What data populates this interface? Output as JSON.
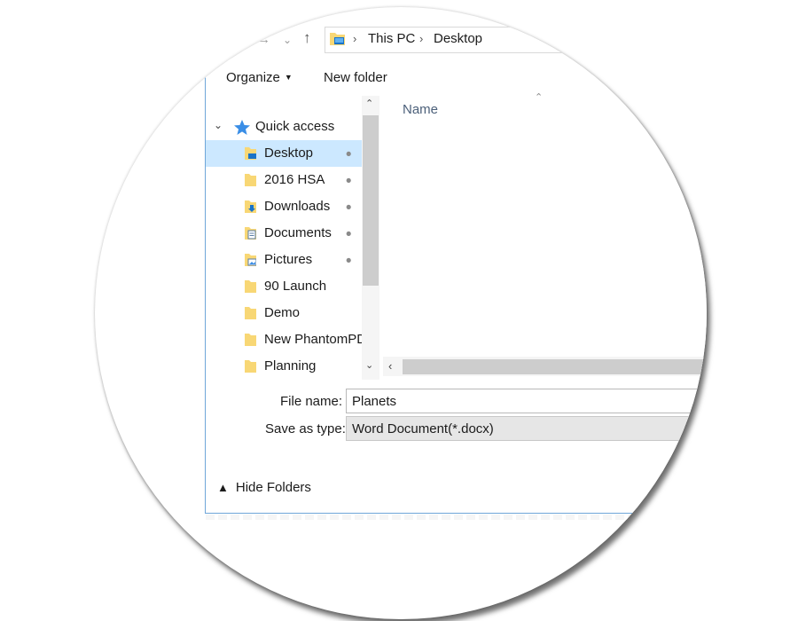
{
  "address_bar": {
    "crumbs": [
      "This PC",
      "Desktop"
    ]
  },
  "toolbar": {
    "organize_label": "Organize",
    "new_folder_label": "New folder"
  },
  "nav_pane": {
    "quick_access_label": "Quick access",
    "items": [
      {
        "label": "Desktop",
        "icon": "desktop-folder-icon",
        "pinned": true,
        "selected": true
      },
      {
        "label": "2016 HSA",
        "icon": "folder-icon",
        "pinned": true
      },
      {
        "label": "Downloads",
        "icon": "downloads-folder-icon",
        "pinned": true
      },
      {
        "label": "Documents",
        "icon": "documents-folder-icon",
        "pinned": true
      },
      {
        "label": "Pictures",
        "icon": "pictures-folder-icon",
        "pinned": true
      },
      {
        "label": "90 Launch",
        "icon": "folder-icon",
        "pinned": false
      },
      {
        "label": "Demo",
        "icon": "folder-icon",
        "pinned": false
      },
      {
        "label": "New PhantomPD",
        "icon": "folder-icon",
        "pinned": false
      },
      {
        "label": "Planning",
        "icon": "folder-icon",
        "pinned": false
      }
    ]
  },
  "file_list": {
    "column_name": "Name"
  },
  "form": {
    "file_name_label": "File name:",
    "file_name_value": "Planets",
    "save_as_type_label": "Save as type:",
    "save_as_type_value": "Word Document(*.docx)"
  },
  "footer": {
    "hide_folders_label": "Hide Folders"
  },
  "colors": {
    "selection": "#cce8ff",
    "folder": "#f8d775",
    "accent": "#0078d7"
  }
}
